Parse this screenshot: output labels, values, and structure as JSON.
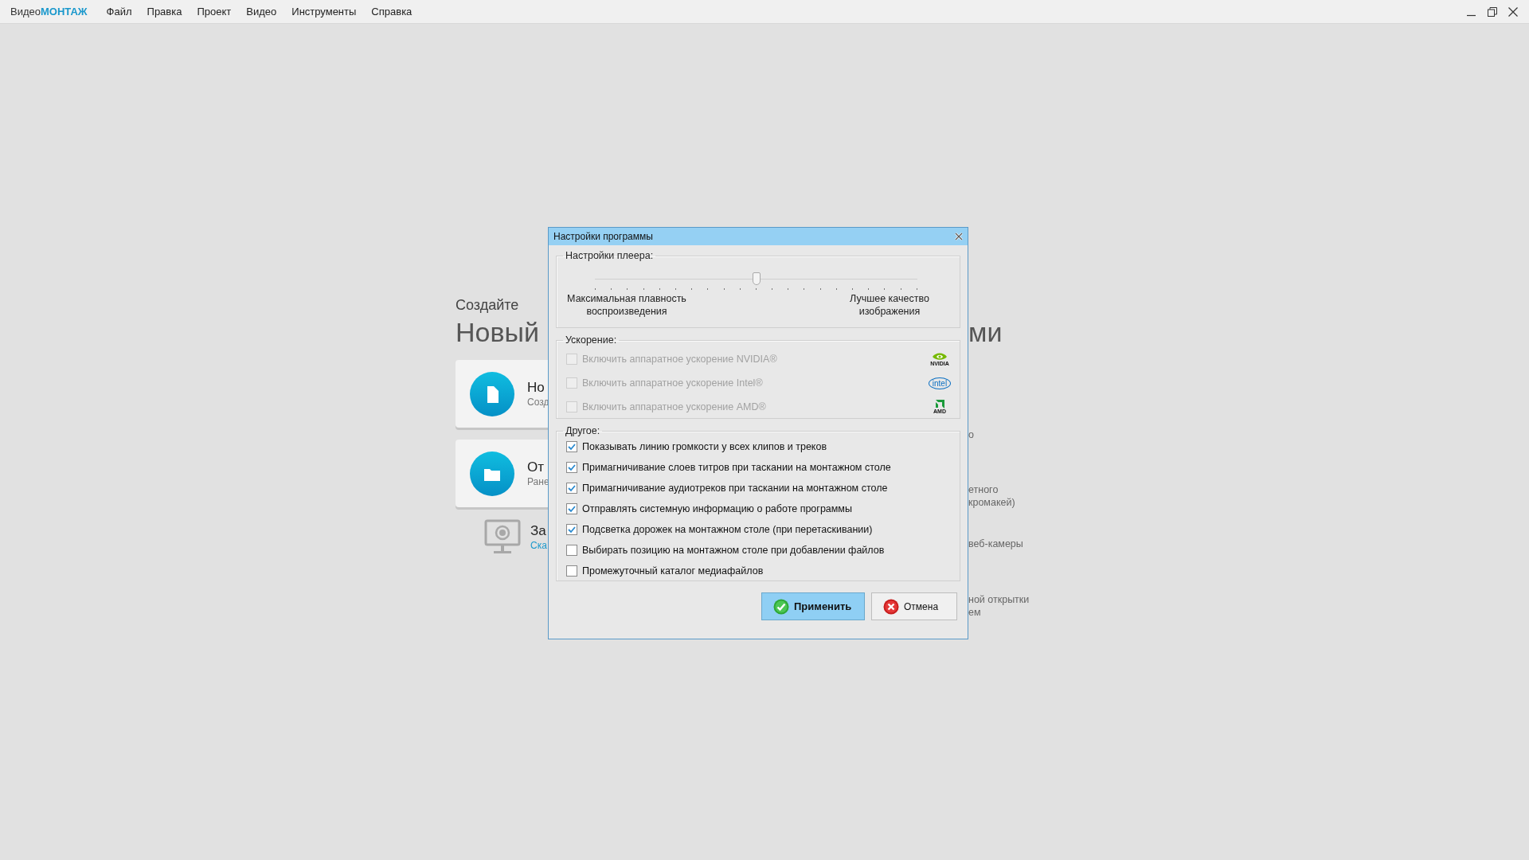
{
  "app": {
    "logo_prefix": "Видео",
    "logo_accent": "МОНТАЖ"
  },
  "menu": [
    "Файл",
    "Правка",
    "Проект",
    "Видео",
    "Инструменты",
    "Справка"
  ],
  "background": {
    "heading_small": "Создайте",
    "heading_large_left": "Новый",
    "heading_large_right": "ми",
    "cards": [
      {
        "kind": "new",
        "title": "Но",
        "subtitle": "Созд"
      },
      {
        "kind": "open",
        "title": "От",
        "subtitle": "Ране"
      }
    ],
    "record": {
      "title": "За",
      "link": "Ска"
    },
    "right_fragments": [
      "о",
      "етного",
      "кромакей)",
      "веб-камеры",
      "ной открытки",
      "ем"
    ]
  },
  "dialog": {
    "title": "Настройки программы",
    "player": {
      "label": "Настройки плеера:",
      "level": 0.5,
      "left_label": "Максимальная плавность воспроизведения",
      "right_label": "Лучшее качество изображения"
    },
    "acceleration": {
      "label": "Ускорение:",
      "options": [
        {
          "label": "Включить аппаратное ускорение NVIDIA®",
          "checked": false,
          "disabled": true,
          "kind": "nvidia",
          "logo": "NVIDIA"
        },
        {
          "label": "Включить аппаратное ускорение Intel®",
          "checked": false,
          "disabled": true,
          "kind": "intel",
          "logo": "intel"
        },
        {
          "label": "Включить аппаратное ускорение AMD®",
          "checked": false,
          "disabled": true,
          "kind": "amd",
          "logo": "AMD"
        }
      ]
    },
    "other": {
      "label": "Другое:",
      "options": [
        {
          "label": "Показывать линию громкости у всех клипов и треков",
          "checked": true,
          "disabled": false
        },
        {
          "label": "Примагничивание слоев титров при таскании на монтажном столе",
          "checked": true,
          "disabled": false
        },
        {
          "label": "Примагничивание аудиотреков при таскании на монтажном столе",
          "checked": true,
          "disabled": false
        },
        {
          "label": "Отправлять системную информацию о работе программы",
          "checked": true,
          "disabled": false
        },
        {
          "label": "Подсветка дорожек на монтажном столе (при перетаскивании)",
          "checked": true,
          "disabled": false
        },
        {
          "label": "Выбирать позицию на монтажном столе при добавлении файлов",
          "checked": false,
          "disabled": false
        },
        {
          "label": "Промежуточный каталог медиафайлов",
          "checked": false,
          "disabled": false
        }
      ]
    },
    "buttons": [
      {
        "kind": "apply",
        "label": "Применить"
      },
      {
        "kind": "cancel",
        "label": "Отмена"
      }
    ]
  }
}
